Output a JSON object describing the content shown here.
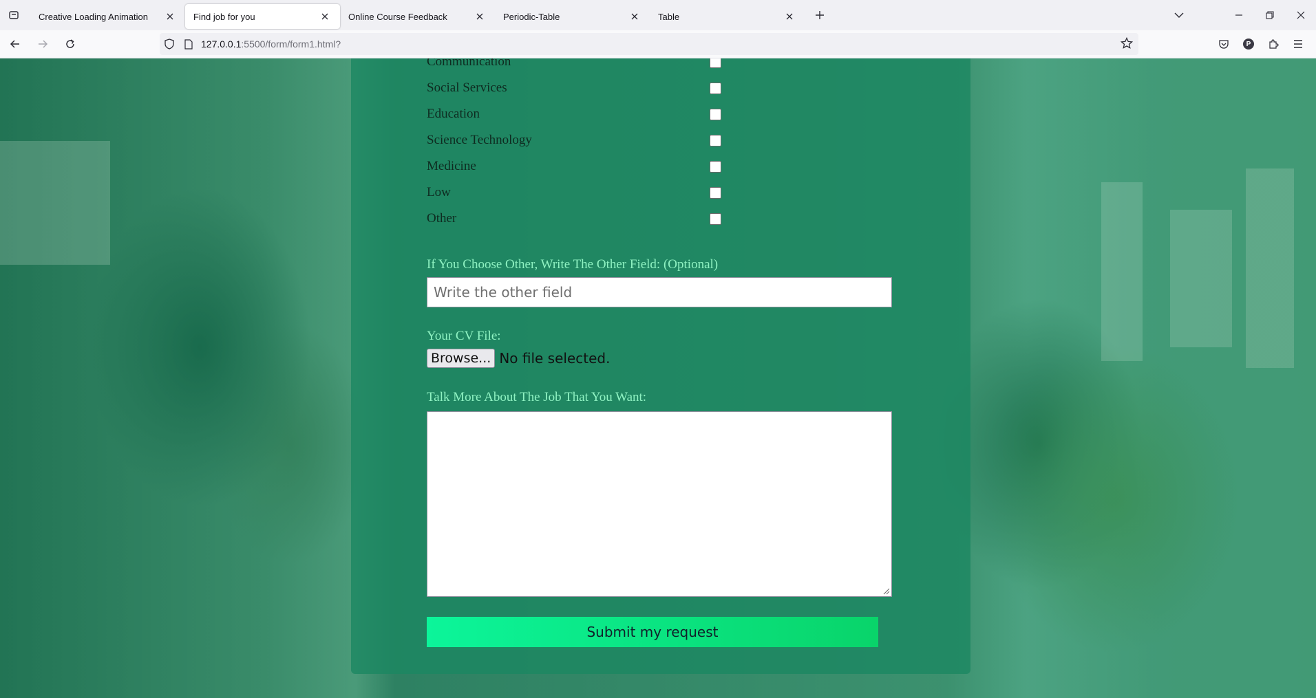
{
  "browser": {
    "tabs": [
      {
        "title": "Creative Loading Animation",
        "active": false
      },
      {
        "title": "Find job for you",
        "active": true
      },
      {
        "title": "Online Course Feedback",
        "active": false
      },
      {
        "title": "Periodic-Table",
        "active": false
      },
      {
        "title": "Table",
        "active": false
      }
    ],
    "url_host": "127.0.0.1",
    "url_rest": ":5500/form/form1.html?",
    "profile_initial": "P"
  },
  "form": {
    "categories": [
      {
        "label": "Communication",
        "checked": false
      },
      {
        "label": "Social Services",
        "checked": false
      },
      {
        "label": "Education",
        "checked": false
      },
      {
        "label": "Science Technology",
        "checked": false
      },
      {
        "label": "Medicine",
        "checked": false
      },
      {
        "label": "Low",
        "checked": false
      },
      {
        "label": "Other",
        "checked": false
      }
    ],
    "other_field": {
      "label": "If You Choose Other, Write The Other Field: (Optional)",
      "placeholder": "Write the other field"
    },
    "cv_file": {
      "label": "Your CV File:",
      "button_label": "Browse...",
      "status": "No file selected."
    },
    "job_details": {
      "label": "Talk More About The Job That You Want:"
    },
    "submit_label": "Submit my request"
  },
  "colors": {
    "accent_label": "#8ff2c2",
    "card_bg": "#1c8762",
    "submit_start": "#0cf59a",
    "submit_end": "#09d46a"
  }
}
